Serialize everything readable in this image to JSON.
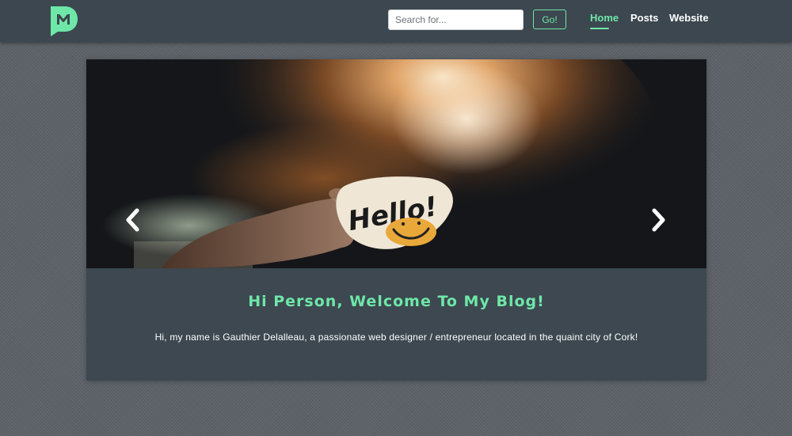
{
  "header": {
    "logo_icon": "m-chat-bubble-logo",
    "logo_color": "#6ee7a8",
    "search": {
      "placeholder": "Search for...",
      "value": ""
    },
    "go_label": "Go!",
    "nav": [
      {
        "label": "Home",
        "active": true
      },
      {
        "label": "Posts",
        "active": false
      },
      {
        "label": "Website",
        "active": false
      }
    ],
    "accent_color": "#6ee7a8",
    "background_color": "#3c474f"
  },
  "carousel": {
    "prev_icon": "chevron-left-icon",
    "next_icon": "chevron-right-icon",
    "slide_image": "hand-holding-hello-sticker-photo",
    "slide_text": "Hello!",
    "caption_title": "Hi Person, Welcome To My Blog!",
    "caption_text": "Hi, my name is Gauthier Delalleau, a passionate web designer / entrepreneur located in the quaint city of Cork!"
  }
}
